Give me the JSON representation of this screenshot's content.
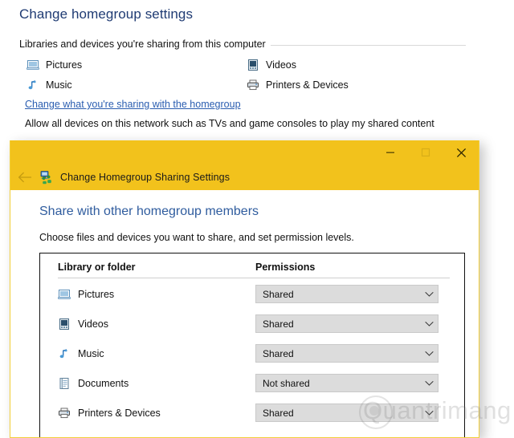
{
  "control_panel": {
    "title": "Change homegroup settings",
    "group_header": "Libraries and devices you're sharing from this computer",
    "shared_items": [
      {
        "label": "Pictures",
        "icon": "pictures-icon"
      },
      {
        "label": "Videos",
        "icon": "videos-icon"
      },
      {
        "label": "Music",
        "icon": "music-icon"
      },
      {
        "label": "Printers & Devices",
        "icon": "printers-devices-icon"
      }
    ],
    "link": "Change what you're sharing with the homegroup",
    "note": "Allow all devices on this network such as TVs and game consoles to play my shared content"
  },
  "dialog": {
    "titlebar": {
      "title": "Change Homegroup Sharing Settings",
      "app_icon": "homegroup-icon",
      "back_icon": "back-arrow-icon",
      "minimize": "–",
      "maximize": "□",
      "close": "×",
      "accent_color": "#f2c21c"
    },
    "heading": "Share with other homegroup members",
    "subheading": "Choose files and devices you want to share, and set permission levels.",
    "table": {
      "columns": [
        "Library or folder",
        "Permissions"
      ],
      "rows": [
        {
          "label": "Pictures",
          "icon": "pictures-icon",
          "permission": "Shared"
        },
        {
          "label": "Videos",
          "icon": "videos-icon",
          "permission": "Shared"
        },
        {
          "label": "Music",
          "icon": "music-icon",
          "permission": "Shared"
        },
        {
          "label": "Documents",
          "icon": "documents-icon",
          "permission": "Not shared"
        },
        {
          "label": "Printers & Devices",
          "icon": "printers-devices-icon",
          "permission": "Shared"
        }
      ],
      "permission_options": [
        "Shared",
        "Not shared"
      ]
    }
  },
  "watermark": {
    "text": "Quantrimang"
  }
}
